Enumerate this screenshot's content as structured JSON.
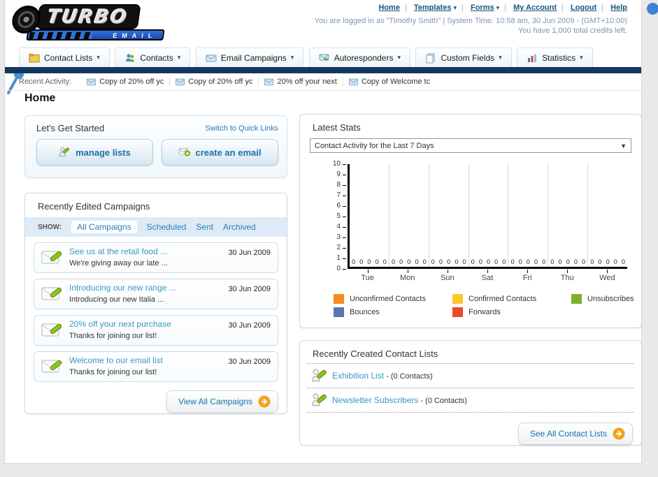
{
  "header": {
    "logo_title": "TURBO",
    "logo_subtitle": "EMAIL",
    "nav": [
      {
        "label": "Home"
      },
      {
        "label": "Templates",
        "dropdown": true
      },
      {
        "label": "Forms",
        "dropdown": true
      },
      {
        "label": "My Account"
      },
      {
        "label": "Logout"
      },
      {
        "label": "Help"
      }
    ],
    "nav_separator": "|",
    "status_line1": "You are logged in as \"Timothy Smith\" | System Time: 10:58 am, 30 Jun 2009 - (GMT+10:00)",
    "status_line2": "You have 1,000 total credits left."
  },
  "tabs": [
    {
      "label": "Contact Lists",
      "icon": "folder-icon"
    },
    {
      "label": "Contacts",
      "icon": "people-icon"
    },
    {
      "label": "Email Campaigns",
      "icon": "envelope-icon"
    },
    {
      "label": "Autoresponders",
      "icon": "envelope-arrow-icon"
    },
    {
      "label": "Custom Fields",
      "icon": "pages-icon"
    },
    {
      "label": "Statistics",
      "icon": "bar-chart-icon"
    }
  ],
  "recent_activity": {
    "label": "Recent Activity:",
    "items": [
      {
        "text": "Copy of 20% off yc"
      },
      {
        "text": "Copy of 20% off yc"
      },
      {
        "text": "20% off your next"
      },
      {
        "text": "Copy of Welcome tc"
      }
    ]
  },
  "page_title": "Home",
  "get_started": {
    "title": "Let's Get Started",
    "switch_link": "Switch to Quick Links",
    "buttons": [
      {
        "label": "manage lists",
        "icon": "person-pencil-icon"
      },
      {
        "label": "create an email",
        "icon": "envelope-plus-icon"
      }
    ]
  },
  "campaigns": {
    "title": "Recently Edited Campaigns",
    "show_label": "SHOW:",
    "filters": [
      "All Campaigns",
      "Scheduled",
      "Sent",
      "Archived"
    ],
    "active_filter": "All Campaigns",
    "items": [
      {
        "title": "See us at the retail food ...",
        "subtitle": "We're giving away our late ...",
        "date": "30 Jun 2009"
      },
      {
        "title": "Introducing our new range ...",
        "subtitle": "Introducing our new Italia ...",
        "date": "30 Jun 2009"
      },
      {
        "title": "20% off your next purchase",
        "subtitle": "Thanks for joining our list!",
        "date": "30 Jun 2009"
      },
      {
        "title": "Welcome to our email list",
        "subtitle": "Thanks for joining our list!",
        "date": "30 Jun 2009"
      }
    ],
    "view_all_label": "View All Campaigns"
  },
  "stats": {
    "title": "Latest Stats",
    "dropdown_value": "Contact Activity for the Last 7 Days"
  },
  "chart_data": {
    "type": "bar",
    "title": "Contact Activity for the Last 7 Days",
    "categories": [
      "Tue",
      "Mon",
      "Sun",
      "Sat",
      "Fri",
      "Thu",
      "Wed"
    ],
    "series": [
      {
        "name": "Unconfirmed Contacts",
        "color": "#f68b1f",
        "values": [
          0,
          0,
          0,
          0,
          0,
          0,
          0
        ]
      },
      {
        "name": "Confirmed Contacts",
        "color": "#fdc62b",
        "values": [
          0,
          0,
          0,
          0,
          0,
          0,
          0
        ]
      },
      {
        "name": "Unsubscribes",
        "color": "#7cb02c",
        "values": [
          0,
          0,
          0,
          0,
          0,
          0,
          0
        ]
      },
      {
        "name": "Bounces",
        "color": "#5a76ad",
        "values": [
          0,
          0,
          0,
          0,
          0,
          0,
          0
        ]
      },
      {
        "name": "Forwards",
        "color": "#e8492a",
        "values": [
          0,
          0,
          0,
          0,
          0,
          0,
          0
        ]
      }
    ],
    "xlabel": "",
    "ylabel": "",
    "ylim": [
      0,
      10
    ],
    "ytick_step": 1,
    "grid": "vertical-group-separators",
    "legend_position": "bottom"
  },
  "contact_lists": {
    "title": "Recently Created Contact Lists",
    "items": [
      {
        "name": "Exhibition List",
        "count": " - (0 Contacts)"
      },
      {
        "name": "Newsletter Subscribers",
        "count": " - (0 Contacts)"
      }
    ],
    "see_all_label": "See All Contact Lists"
  }
}
